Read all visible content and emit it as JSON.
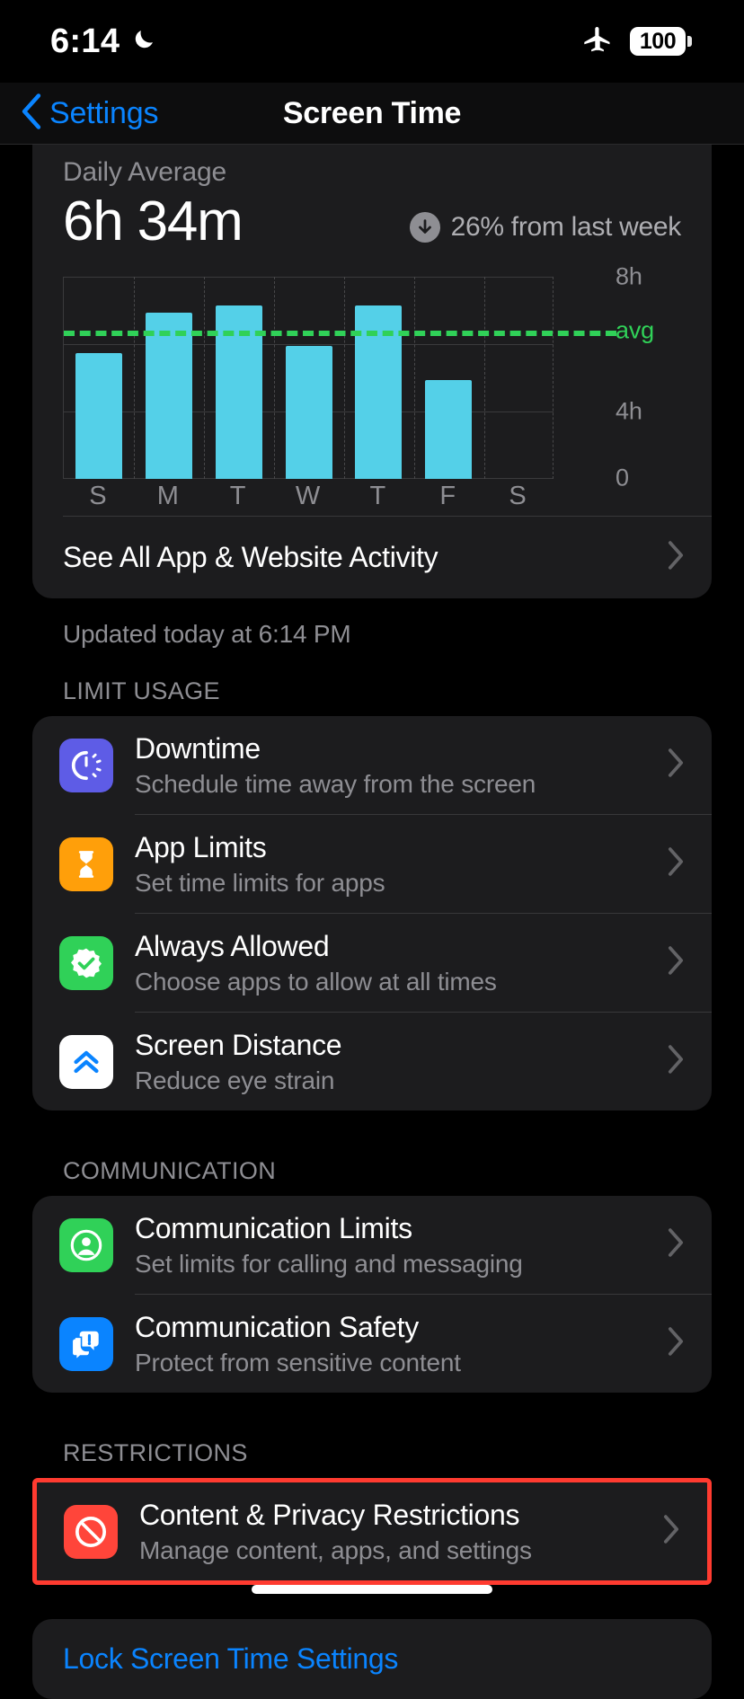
{
  "status_bar": {
    "time": "6:14",
    "dnd_icon": "moon-icon",
    "airplane_icon": "airplane-icon",
    "battery_level": "100"
  },
  "nav": {
    "back_label": "Settings",
    "back_icon": "chevron-left-icon",
    "title": "Screen Time"
  },
  "summary": {
    "label": "Daily Average",
    "value": "6h 34m",
    "delta_icon": "arrow-down-circle-icon",
    "delta_text": "26% from last week"
  },
  "chart_data": {
    "type": "bar",
    "title": "Daily Average",
    "categories": [
      "S",
      "M",
      "T",
      "W",
      "T",
      "F",
      "S"
    ],
    "values": [
      5.6,
      7.4,
      7.7,
      5.9,
      7.7,
      4.4,
      0
    ],
    "value_unit": "hours",
    "ylim": [
      0,
      9
    ],
    "yticks": [
      0,
      4,
      8
    ],
    "ytick_labels": [
      "0",
      "4h",
      "8h"
    ],
    "xlabel": "",
    "ylabel": "",
    "grid": true,
    "legend": "none",
    "average_line": {
      "label": "avg",
      "value": 6.566,
      "style": "dashed",
      "color": "#30d158"
    },
    "bar_color": "#54d0e8"
  },
  "see_all_row": {
    "label": "See All App & Website Activity",
    "chevron_icon": "chevron-right-icon"
  },
  "updated_note": "Updated today at 6:14 PM",
  "sections": [
    {
      "header": "LIMIT USAGE",
      "rows": [
        {
          "title": "Downtime",
          "subtitle": "Schedule time away from the screen",
          "icon": "downtime-clock-icon",
          "icon_bg": "#5e5ce6",
          "chevron_icon": "chevron-right-icon"
        },
        {
          "title": "App Limits",
          "subtitle": "Set time limits for apps",
          "icon": "hourglass-icon",
          "icon_bg": "#ff9f0a",
          "chevron_icon": "chevron-right-icon"
        },
        {
          "title": "Always Allowed",
          "subtitle": "Choose apps to allow at all times",
          "icon": "check-badge-icon",
          "icon_bg": "#30d158",
          "chevron_icon": "chevron-right-icon"
        },
        {
          "title": "Screen Distance",
          "subtitle": "Reduce eye strain",
          "icon": "double-chevron-up-icon",
          "icon_bg": "#ffffff",
          "chevron_icon": "chevron-right-icon"
        }
      ]
    },
    {
      "header": "COMMUNICATION",
      "rows": [
        {
          "title": "Communication Limits",
          "subtitle": "Set limits for calling and messaging",
          "icon": "person-circle-icon",
          "icon_bg": "#30d158",
          "chevron_icon": "chevron-right-icon"
        },
        {
          "title": "Communication Safety",
          "subtitle": "Protect from sensitive content",
          "icon": "message-alert-icon",
          "icon_bg": "#0a84ff",
          "chevron_icon": "chevron-right-icon"
        }
      ]
    },
    {
      "header": "RESTRICTIONS",
      "rows": [
        {
          "title": "Content & Privacy Restrictions",
          "subtitle": "Manage content, apps, and settings",
          "icon": "prohibition-icon",
          "icon_bg": "#ff453a",
          "chevron_icon": "chevron-right-icon",
          "highlighted": true
        }
      ]
    }
  ],
  "bottom_link": "Lock Screen Time Settings",
  "annotation": {
    "color": "#ff3b30"
  }
}
